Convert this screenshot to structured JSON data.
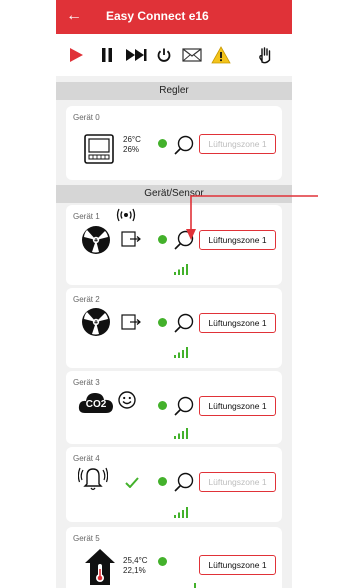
{
  "header": {
    "title": "Easy Connect e16",
    "back_icon": "←"
  },
  "toolbar": {
    "icons": [
      "play-icon",
      "pause-icon",
      "fast-forward-icon",
      "power-icon",
      "mail-icon",
      "warning-icon",
      "hand-icon"
    ],
    "accent": "#e03238"
  },
  "sections": {
    "regler": "Regler",
    "geraet_sensor": "Gerät/Sensor"
  },
  "regler_device": {
    "label": "Gerät 0",
    "temperature": "26°C",
    "humidity": "26%",
    "zone": "Lüftungszone 1"
  },
  "devices": [
    {
      "label": "Gerät 1",
      "zone": "Lüftungszone 1"
    },
    {
      "label": "Gerät 2",
      "zone": "Lüftungszone 1"
    },
    {
      "label": "Gerät 3",
      "co2_text": "CO2",
      "zone": "Lüftungszone 1"
    },
    {
      "label": "Gerät 4",
      "zone": "Lüftungszone 1"
    },
    {
      "label": "Gerät 5",
      "temperature": "25,4°C",
      "humidity": "22,1%",
      "zone": "Lüftungszone 1"
    }
  ],
  "colors": {
    "status_green": "#43b12b",
    "brand_red": "#e03238"
  }
}
